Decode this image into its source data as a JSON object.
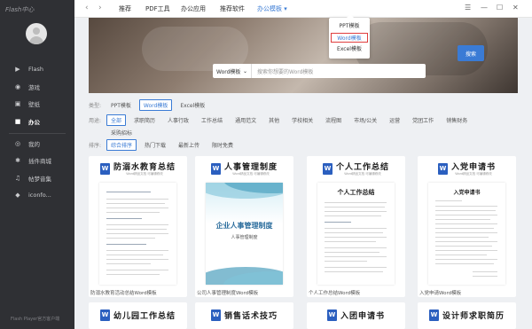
{
  "app": {
    "logo": "Flash中心"
  },
  "sidebar": {
    "items": [
      {
        "label": "Flash",
        "icon": "play-icon"
      },
      {
        "label": "游戏",
        "icon": "gamepad-icon"
      },
      {
        "label": "壁纸",
        "icon": "wallpaper-icon"
      },
      {
        "label": "办公",
        "icon": "briefcase-icon"
      },
      {
        "label": "我的",
        "icon": "user-icon"
      },
      {
        "label": "插件商城",
        "icon": "plugin-icon"
      },
      {
        "label": "帖梦音集",
        "icon": "headphones-icon"
      },
      {
        "label": "iconfo...",
        "icon": "app-icon"
      }
    ],
    "footer": "Flash Player官方客户端"
  },
  "topbar": {
    "tabs": [
      "推荐",
      "PDF工具",
      "办公应用",
      "推荐软件",
      "办公模板 ▾"
    ],
    "active_tab": "办公模板 ▾"
  },
  "dropdown": {
    "items": [
      "PPT模板",
      "Word模板",
      "Excel模板"
    ],
    "selected": "Word模板"
  },
  "search": {
    "type": "Word模板",
    "placeholder": "搜索你想要的Word模板",
    "button": "搜索"
  },
  "filters": {
    "type_label": "类型:",
    "types": [
      "PPT模板",
      "Word模板",
      "Excel模板"
    ],
    "use_label": "用途:",
    "uses": [
      "全部",
      "求职简历",
      "人事行政",
      "工作总结",
      "通用范文",
      "其他",
      "学校相关",
      "流程图",
      "市场/公关",
      "运营",
      "党团工作",
      "销售财务",
      "采购招标"
    ],
    "sort_label": "排序:",
    "sorts": [
      "综合排序",
      "热门下载",
      "最新上传",
      "限时免费"
    ]
  },
  "cards": [
    {
      "title": "防溺水教育总结",
      "sub": "Word精品文档 可编辑修改",
      "caption": "防溺水教育活动总结Word模板"
    },
    {
      "title": "人事管理制度",
      "sub": "Word精品文档 可编辑修改",
      "caption": "公司人事管理制度Word模板",
      "cover_title": "企业人事管理制度",
      "cover_sub": "人事管理制度"
    },
    {
      "title": "个人工作总结",
      "sub": "Word精品文档 可编辑修改",
      "caption": "个人工作总结Word模板",
      "thumb_title": "个人工作总结"
    },
    {
      "title": "入党申请书",
      "sub": "Word精品文档 可编辑修改",
      "caption": "入党申请Word模板",
      "thumb_title": "入党申请书"
    }
  ],
  "cards_row2": [
    {
      "title": "幼儿园工作总结"
    },
    {
      "title": "销售话术技巧"
    },
    {
      "title": "入团申请书"
    },
    {
      "title": "设计师求职简历"
    }
  ],
  "colors": {
    "accent": "#3a7bd5",
    "sidebar": "#2f3034",
    "highlight_border": "#e03e3e",
    "word_icon": "#2b5fbf"
  }
}
